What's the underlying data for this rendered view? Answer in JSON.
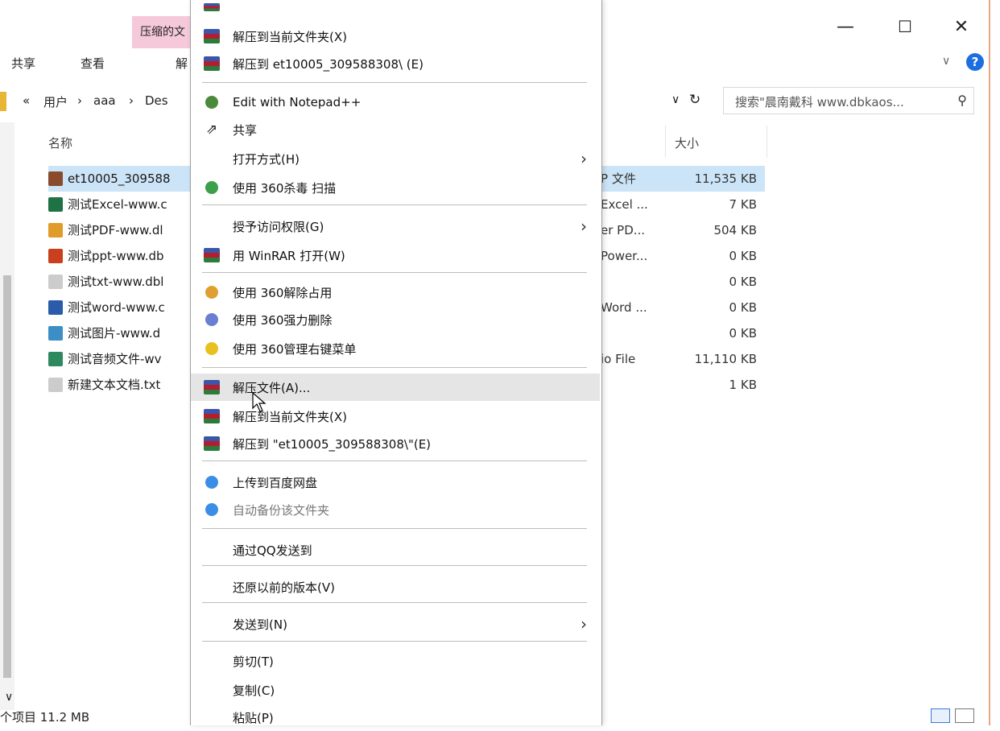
{
  "window": {
    "ribbon_context_tab": "压缩的文",
    "menu_tabs": [
      "共享",
      "查看",
      "解"
    ],
    "minimize": "—",
    "maximize": "☐",
    "close": "✕"
  },
  "address": {
    "back_chevron": "«",
    "path": [
      "用户",
      "aaa",
      "Des"
    ],
    "separator": "›",
    "search_placeholder": "搜索\"晨南戴科 www.dbkaos..."
  },
  "columns": {
    "name": "名称",
    "size": "大小"
  },
  "files": [
    {
      "name": "et10005_309588",
      "type": "P 文件",
      "size": "11,535 KB",
      "icon": "winrar-icon",
      "color": "#8a4b2c"
    },
    {
      "name": "测试Excel-www.c",
      "type": "Excel ...",
      "size": "7 KB",
      "icon": "excel-icon",
      "color": "#1f7244"
    },
    {
      "name": "测试PDF-www.dl",
      "type": "er PD...",
      "size": "504 KB",
      "icon": "pdf-icon",
      "color": "#e09b2a"
    },
    {
      "name": "测试ppt-www.db",
      "type": "Power...",
      "size": "0 KB",
      "icon": "ppt-icon",
      "color": "#c9401f"
    },
    {
      "name": "测试txt-www.dbl",
      "type": "",
      "size": "0 KB",
      "icon": "txt-icon",
      "color": "#cccccc"
    },
    {
      "name": "测试word-www.c",
      "type": "Word ...",
      "size": "0 KB",
      "icon": "word-icon",
      "color": "#2a5caa"
    },
    {
      "name": "测试图片-www.d",
      "type": "",
      "size": "0 KB",
      "icon": "image-icon",
      "color": "#3c8fc6"
    },
    {
      "name": "测试音频文件-wv",
      "type": "io File",
      "size": "11,110 KB",
      "icon": "mp3-icon",
      "color": "#2e8a5e"
    },
    {
      "name": "新建文本文档.txt",
      "type": "",
      "size": "1 KB",
      "icon": "txt-icon",
      "color": "#cccccc"
    }
  ],
  "status": "个项目  11.2 MB",
  "menu": {
    "items": [
      {
        "label": "解压到当前文件夹(X)",
        "icon": "winrar-icon"
      },
      {
        "label": "解压到 et10005_309588308\\ (E)",
        "icon": "winrar-icon"
      },
      {
        "label": "Edit with Notepad++",
        "icon": "notepad-icon"
      },
      {
        "label": "共享",
        "icon": "share-icon"
      },
      {
        "label": "打开方式(H)",
        "icon": "",
        "arrow": "›"
      },
      {
        "label": "使用 360杀毒 扫描",
        "icon": "shield-360-icon"
      },
      {
        "label": "授予访问权限(G)",
        "icon": "",
        "arrow": "›"
      },
      {
        "label": "用 WinRAR 打开(W)",
        "icon": "winrar-icon"
      },
      {
        "label": "使用 360解除占用",
        "icon": "unlock-360-icon"
      },
      {
        "label": "使用 360强力删除",
        "icon": "delete-360-icon"
      },
      {
        "label": "使用 360管理右键菜单",
        "icon": "menu-360-icon"
      },
      {
        "label": "解压文件(A)...",
        "icon": "winrar-icon"
      },
      {
        "label": "解压到当前文件夹(X)",
        "icon": "winrar-icon"
      },
      {
        "label": "解压到 \"et10005_309588308\\\"(E)",
        "icon": "winrar-icon"
      },
      {
        "label": "上传到百度网盘",
        "icon": "baidu-cloud-icon"
      },
      {
        "label": "自动备份该文件夹",
        "icon": "baidu-cloud-icon"
      },
      {
        "label": "通过QQ发送到",
        "icon": ""
      },
      {
        "label": "还原以前的版本(V)",
        "icon": ""
      },
      {
        "label": "发送到(N)",
        "icon": "",
        "arrow": "›"
      },
      {
        "label": "剪切(T)",
        "icon": ""
      },
      {
        "label": "复制(C)",
        "icon": ""
      },
      {
        "label": "粘贴(P)",
        "icon": ""
      }
    ]
  }
}
